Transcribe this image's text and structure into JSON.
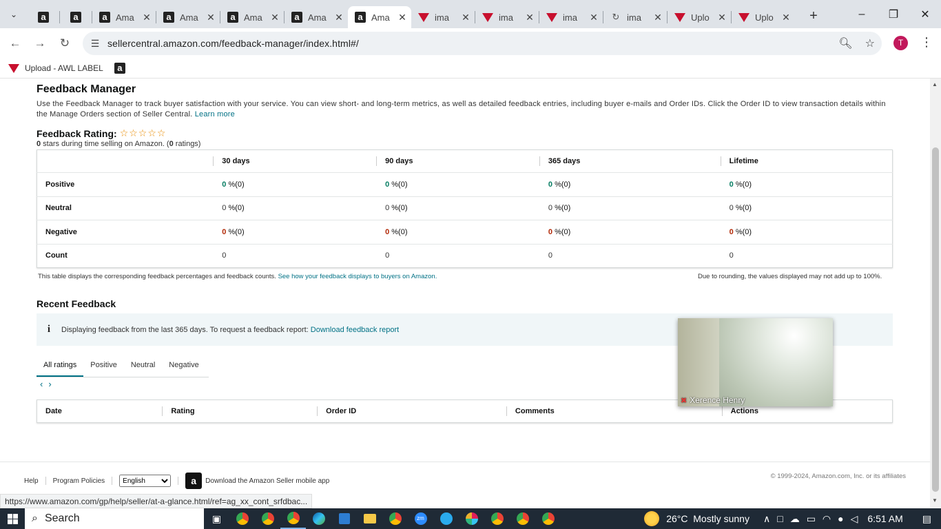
{
  "browser": {
    "tabs": [
      {
        "favicon": "amazon-icon",
        "title": "",
        "small": true
      },
      {
        "favicon": "amazon-icon",
        "title": "",
        "small": true
      },
      {
        "favicon": "amazon-icon",
        "title": "Ama",
        "small": false
      },
      {
        "favicon": "amazon-icon",
        "title": "Ama",
        "small": false
      },
      {
        "favicon": "amazon-icon",
        "title": "Ama",
        "small": false
      },
      {
        "favicon": "amazon-icon",
        "title": "Ama",
        "small": false
      },
      {
        "favicon": "amazon-icon",
        "title": "Ama",
        "small": false,
        "active": true
      },
      {
        "favicon": "awl-icon",
        "title": "ima",
        "small": false
      },
      {
        "favicon": "awl-icon",
        "title": "ima",
        "small": false
      },
      {
        "favicon": "awl-icon",
        "title": "ima",
        "small": false
      },
      {
        "favicon": "link-icon",
        "title": "ima",
        "small": false
      },
      {
        "favicon": "awl-icon",
        "title": "Uplo",
        "small": false
      },
      {
        "favicon": "awl-icon",
        "title": "Uplo",
        "small": false
      }
    ],
    "url": "sellercentral.amazon.com/feedback-manager/index.html#/",
    "profile_initial": "T",
    "bookmarks": [
      {
        "label": "Upload - AWL LABEL",
        "icon": "awl-icon"
      },
      {
        "label": "",
        "icon": "amazon-icon"
      }
    ],
    "status_url": "https://www.amazon.com/gp/help/seller/at-a-glance.html/ref=ag_xx_cont_srfdbac..."
  },
  "page": {
    "title": "Feedback Manager",
    "description": "Use the Feedback Manager to track buyer satisfaction with your service. You can view short- and long-term metrics, as well as detailed feedback entries, including buyer e-mails and Order IDs. Click the Order ID to view transaction details within the Manage Orders section of Seller Central.",
    "learn_more": "Learn more",
    "rating_heading": "Feedback Rating:",
    "stars_filled": 0,
    "stars_total": 5,
    "rating_stars": "0",
    "rating_mid": " stars during time selling on Amazon. (",
    "rating_count": "0",
    "rating_end": " ratings)",
    "table": {
      "columns": [
        "",
        "30 days",
        "90 days",
        "365 days",
        "Lifetime"
      ],
      "rows": [
        {
          "label": "Positive",
          "kind": "pos",
          "cells": [
            [
              "0",
              " %(0)"
            ],
            [
              "0",
              " %(0)"
            ],
            [
              "0",
              " %(0)"
            ],
            [
              "0",
              " %(0)"
            ]
          ]
        },
        {
          "label": "Neutral",
          "kind": "neu",
          "cells": [
            [
              "0",
              " %(0)"
            ],
            [
              "0",
              " %(0)"
            ],
            [
              "0",
              " %(0)"
            ],
            [
              "0",
              " %(0)"
            ]
          ]
        },
        {
          "label": "Negative",
          "kind": "neg",
          "cells": [
            [
              "0",
              " %(0)"
            ],
            [
              "0",
              " %(0)"
            ],
            [
              "0",
              " %(0)"
            ],
            [
              "0",
              " %(0)"
            ]
          ]
        },
        {
          "label": "Count",
          "kind": "count",
          "cells": [
            [
              "0",
              ""
            ],
            [
              "0",
              ""
            ],
            [
              "0",
              ""
            ],
            [
              "0",
              ""
            ]
          ]
        }
      ]
    },
    "note_left": "This table displays the corresponding feedback percentages and feedback counts.",
    "note_left_link": "See how your feedback displays to buyers on Amazon.",
    "note_right": "Due to rounding, the values displayed may not add up to 100%.",
    "recent_title": "Recent Feedback",
    "info_text": "Displaying feedback from the last 365 days. To request a feedback report:",
    "info_link": "Download feedback report",
    "filter_tabs": [
      "All ratings",
      "Positive",
      "Neutral",
      "Negative"
    ],
    "recent_columns": [
      "Date",
      "Rating",
      "Order ID",
      "Comments",
      "Actions"
    ],
    "footer": {
      "help": "Help",
      "policies": "Program Policies",
      "language": "English",
      "app": "Download the Amazon Seller mobile app",
      "copyright": "© 1999-2024, Amazon.com, Inc. or its affiliates"
    }
  },
  "video": {
    "participant": "Xerence Henry"
  },
  "taskbar": {
    "search": "Search",
    "weather": "26°C  Mostly sunny",
    "time": "6:51 AM"
  }
}
